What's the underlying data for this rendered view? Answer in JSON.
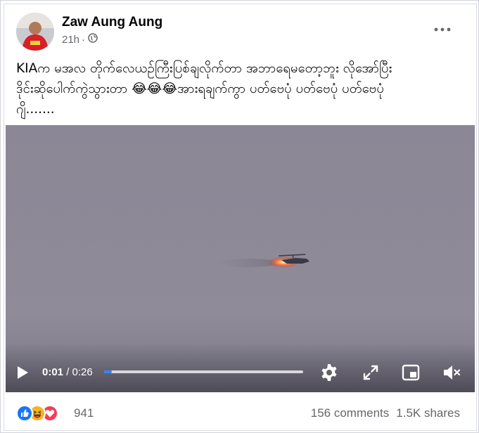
{
  "post": {
    "author": "Zaw Aung Aung",
    "time": "21h",
    "separator": "·",
    "privacy_icon": "globe-icon",
    "more_icon": "more-dots-icon",
    "text": "KIAက မအလ တိုက်လေယဥ်ကြီးပြစ်ချလိုက်တာ အဘာရေမတော့ဘူး လိုအော်ပြီး\nဒိုင်းဆိုပေါက်ကွဲသွားတာ 😂😂😂အားရချက်ကွာ ပတ်ဗေပုံ ပတ်ဗေပုံ ပတ်ဗေပုံ\nဂျိ......."
  },
  "video": {
    "current_time": "0:01",
    "time_separator": " / ",
    "duration": "0:26",
    "progress_fraction": 0.04,
    "icons": [
      "play-icon",
      "settings-gear-icon",
      "fullscreen-expand-icon",
      "picture-in-picture-icon",
      "mute-icon"
    ]
  },
  "engagement": {
    "reaction_icons": [
      "like-icon",
      "haha-icon",
      "love-icon"
    ],
    "reaction_count": "941",
    "comments": "156 comments",
    "shares": "1.5K shares"
  },
  "colors": {
    "progress_fill": "#2d88ff",
    "like": "#1877f2",
    "haha": "#f7b125",
    "love": "#f33e58",
    "secondary_text": "#65676b"
  }
}
